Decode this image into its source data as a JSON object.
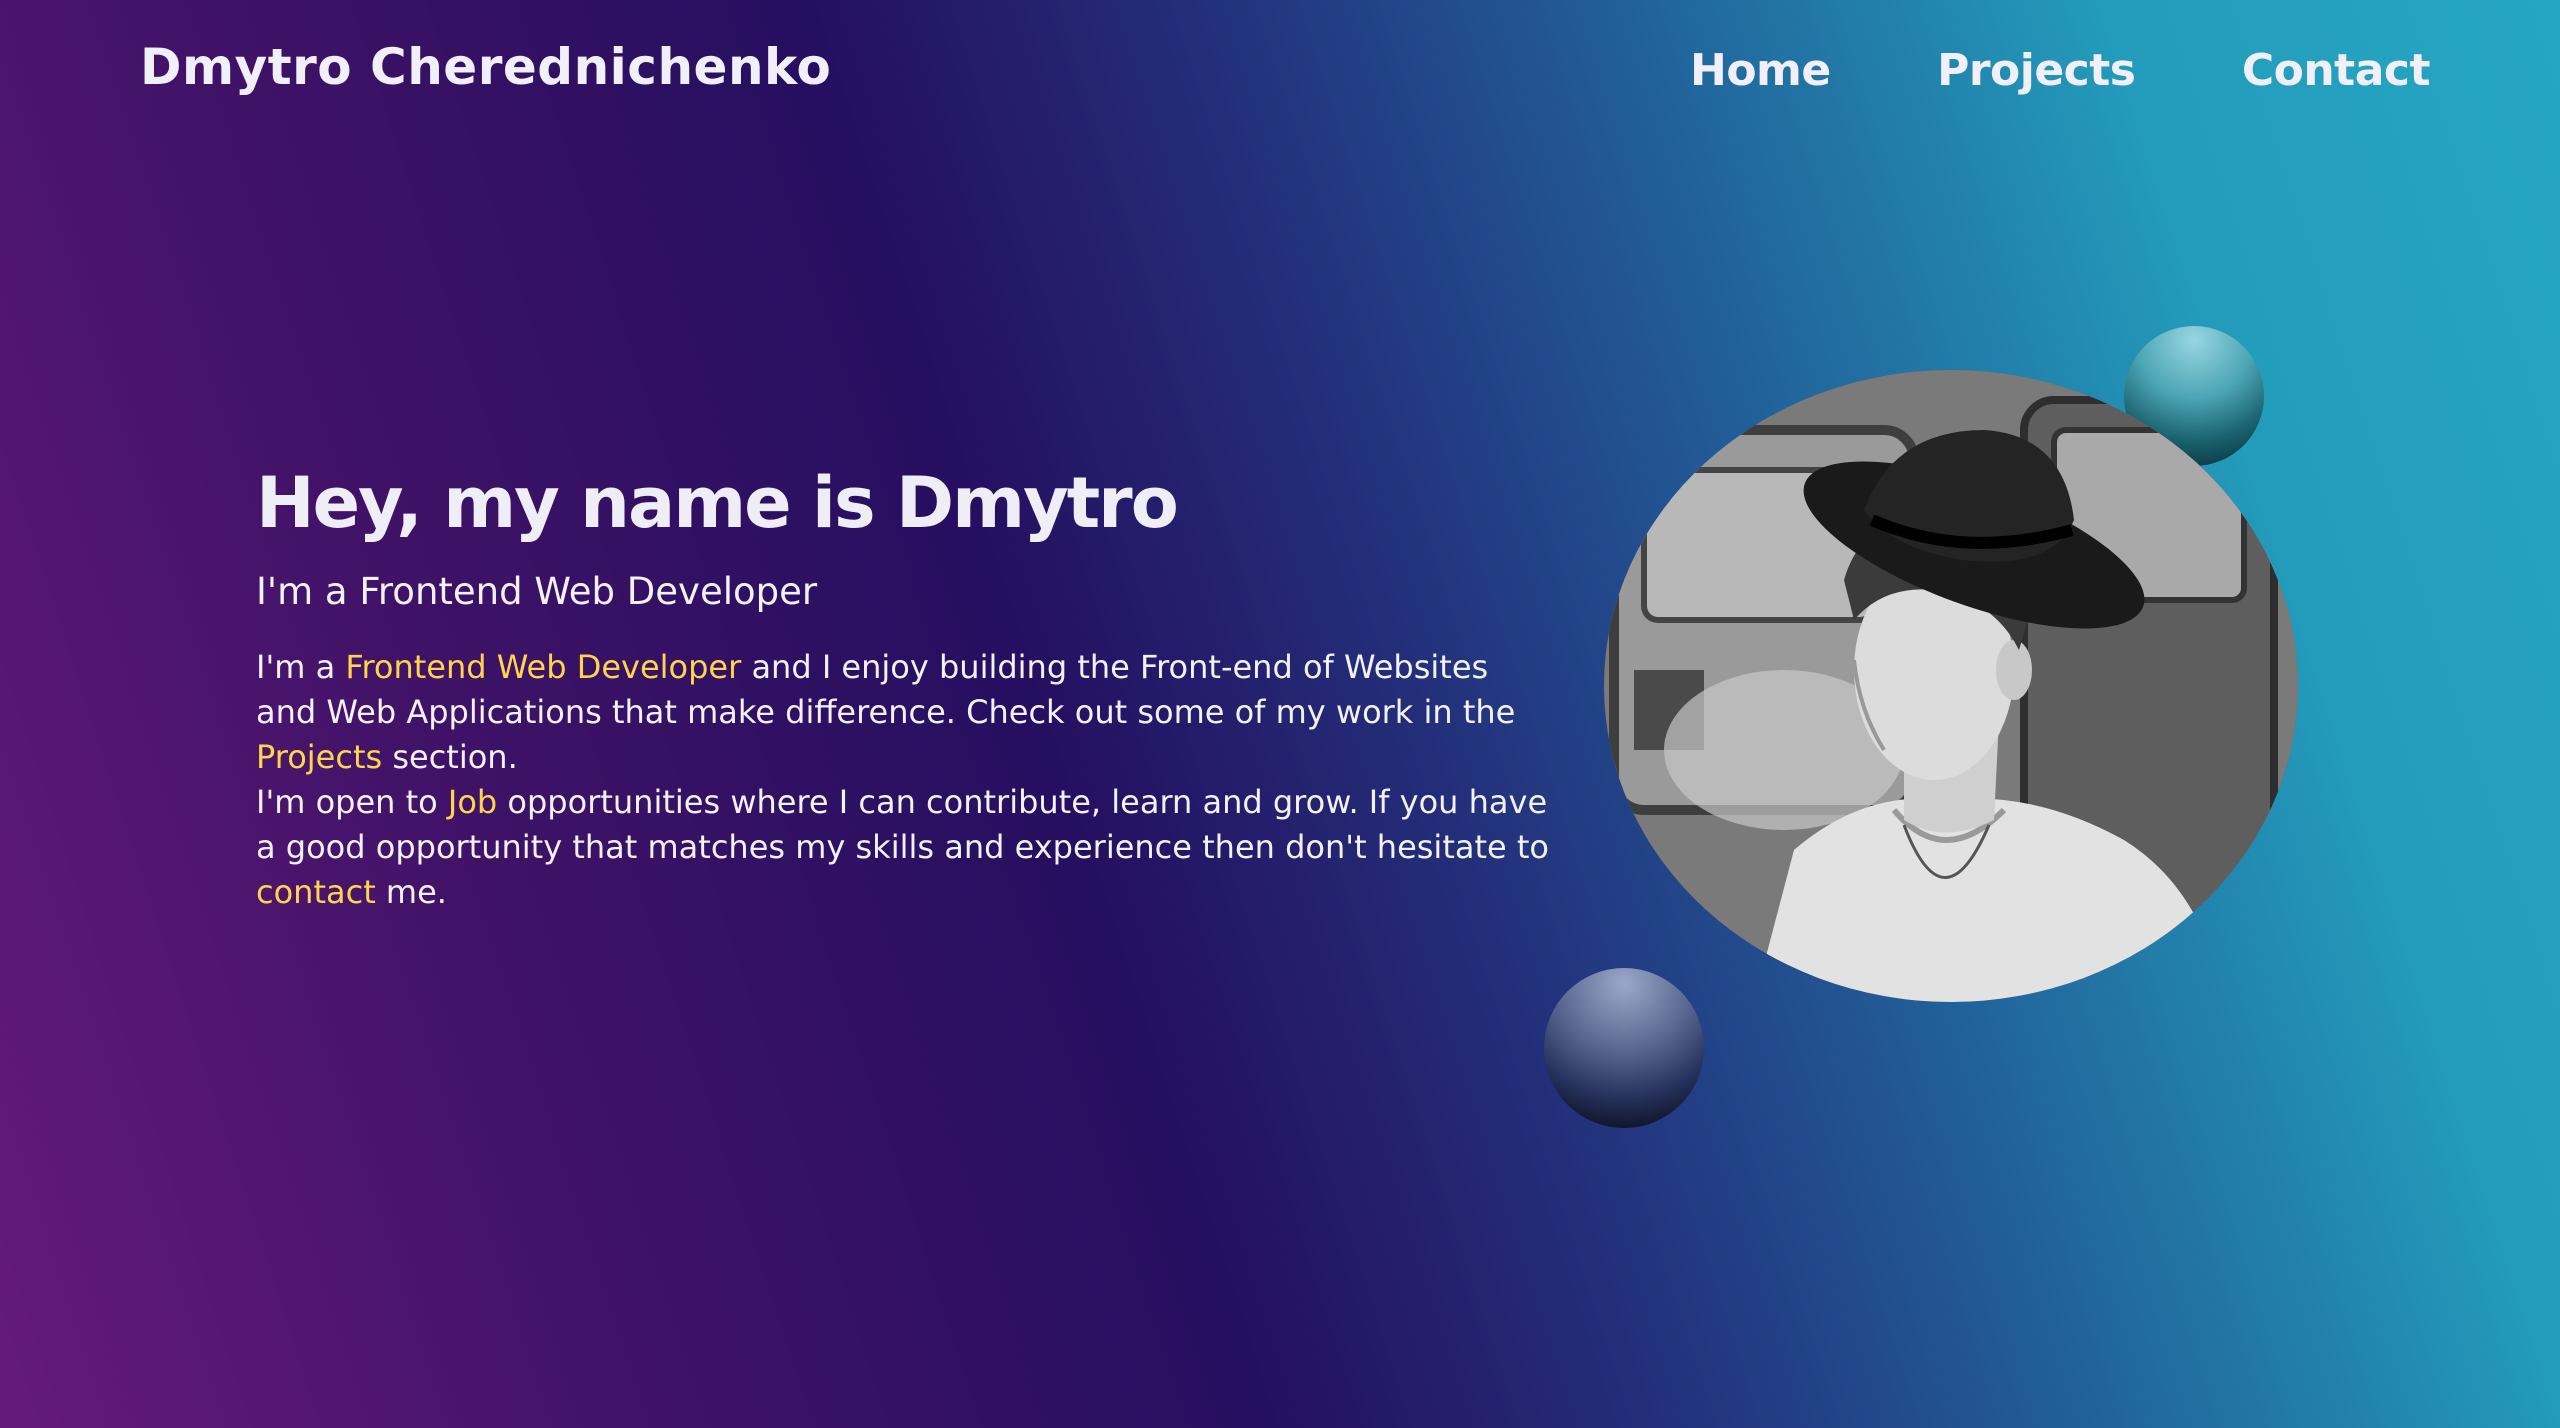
{
  "header": {
    "brand": "Dmytro Cherednichenko",
    "nav": {
      "home": "Home",
      "projects": "Projects",
      "contact": "Contact"
    }
  },
  "hero": {
    "title": "Hey, my name is Dmytro",
    "subtitle": "I'm a Frontend Web Developer",
    "paragraph1": {
      "t1": "I'm a ",
      "link1": "Frontend Web Developer",
      "t2": " and I enjoy building the Front-end of Websites and Web Applications that make difference. Check out some of my work in the ",
      "link2": "Projects",
      "t3": " section."
    },
    "paragraph2": {
      "t1": "I'm open to ",
      "link1": "Job",
      "t2": " opportunities where I can contribute, learn and grow. If you have a good opportunity that matches my skills and experience then don't hesitate to ",
      "link2": "contact",
      "t3": " me."
    }
  },
  "colors": {
    "accent": "#ffd44d",
    "text": "#f3f1f8",
    "gradient_left": "#651a7a",
    "gradient_mid": "#250f60",
    "gradient_right": "#26a6c2"
  }
}
